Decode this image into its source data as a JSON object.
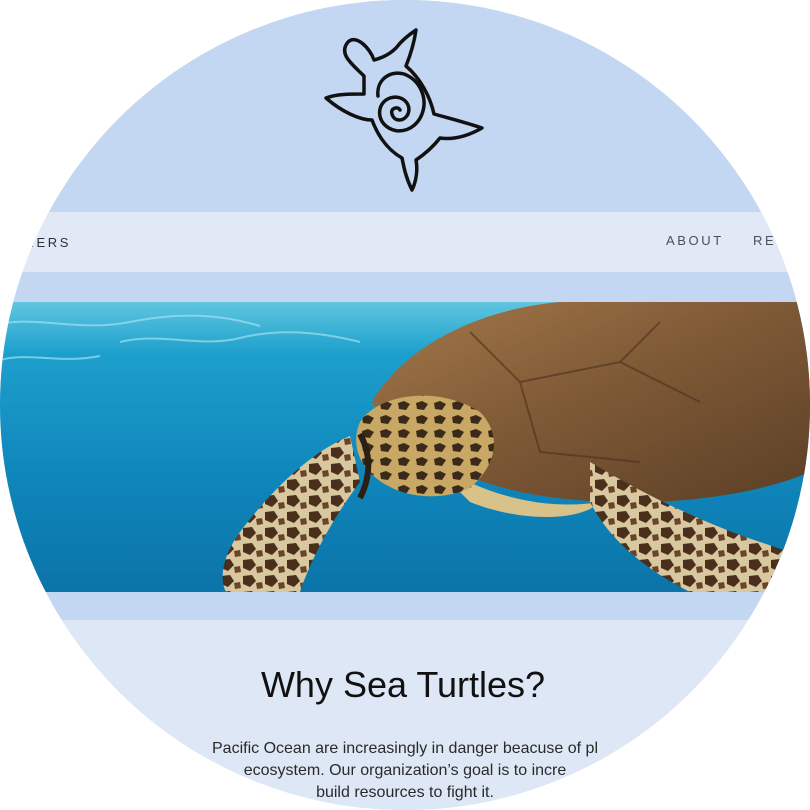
{
  "app": {
    "accent_color": "#c3d7f2",
    "navbar_color": "#e1e9f6"
  },
  "header": {
    "logo": "sea-turtle-spiral-logo"
  },
  "nav": {
    "brand": "RERS",
    "links": [
      {
        "label": "ABOUT"
      },
      {
        "label": "RE"
      }
    ]
  },
  "hero": {
    "image": "sea-turtle-underwater-photo"
  },
  "main": {
    "title": "Why Sea Turtles?",
    "body_lines": [
      "Pacific Ocean are increasingly in danger beacuse of pl",
      "ecosystem. Our organization’s goal is to incre",
      "build resources to fight it."
    ]
  }
}
